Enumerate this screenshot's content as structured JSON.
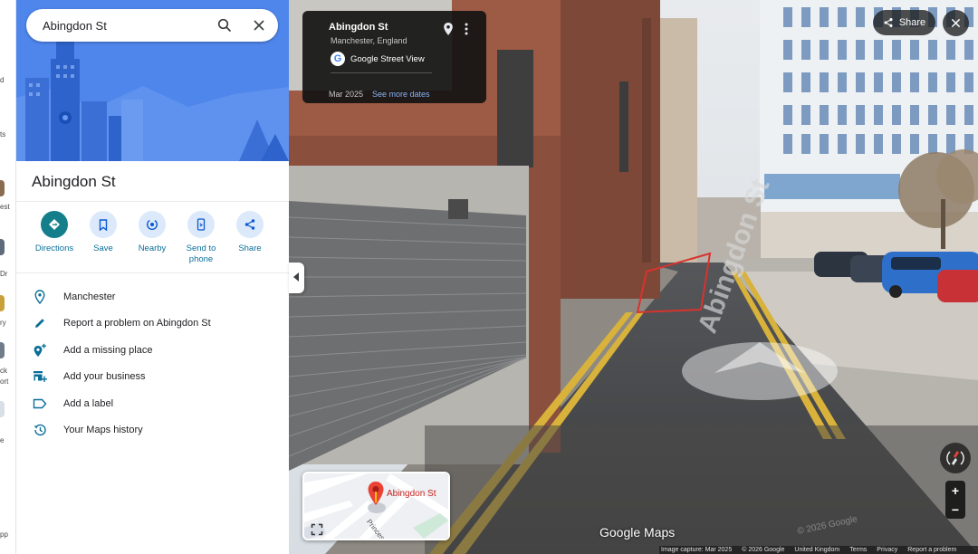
{
  "left_rail": {
    "fragments": [
      "d",
      "ts",
      "est",
      "Dr",
      "ry",
      "ck",
      "ort",
      "e",
      "pp"
    ]
  },
  "search": {
    "value": "Abingdon St",
    "search_icon": "search-icon",
    "close_icon": "close-icon"
  },
  "place": {
    "title": "Abingdon St"
  },
  "actions": [
    {
      "label": "Directions",
      "icon": "directions-icon"
    },
    {
      "label": "Save",
      "icon": "bookmark-icon"
    },
    {
      "label": "Nearby",
      "icon": "nearby-icon"
    },
    {
      "label": "Send to phone",
      "icon": "phone-icon"
    },
    {
      "label": "Share",
      "icon": "share-icon"
    }
  ],
  "menu": [
    {
      "label": "Manchester",
      "icon": "location-pin-icon"
    },
    {
      "label": "Report a problem on Abingdon St",
      "icon": "pencil-icon"
    },
    {
      "label": "Add a missing place",
      "icon": "add-place-icon"
    },
    {
      "label": "Add your business",
      "icon": "add-business-icon"
    },
    {
      "label": "Add a label",
      "icon": "label-icon"
    },
    {
      "label": "Your Maps history",
      "icon": "history-icon"
    }
  ],
  "street_view": {
    "title": "Abingdon St",
    "subtitle": "Manchester, England",
    "provider": "Google Street View",
    "date": "Mar 2025",
    "see_more": "See more dates",
    "share_label": "Share",
    "road_marking": "Abingdon St",
    "minimap_label": "Abingdon St",
    "minimap_street": "Princes",
    "logo": "Google Maps",
    "watermark": "© 2026 Google",
    "colors": {
      "panel_blue": "#4f86ec",
      "directions_teal": "#147f8b",
      "link_blue": "#8ab4f8",
      "red_pin": "#ea4335"
    }
  },
  "footer": {
    "capture": "Image capture: Mar 2025",
    "copyright": "© 2026 Google",
    "country": "United Kingdom",
    "terms": "Terms",
    "privacy": "Privacy",
    "report": "Report a problem"
  }
}
